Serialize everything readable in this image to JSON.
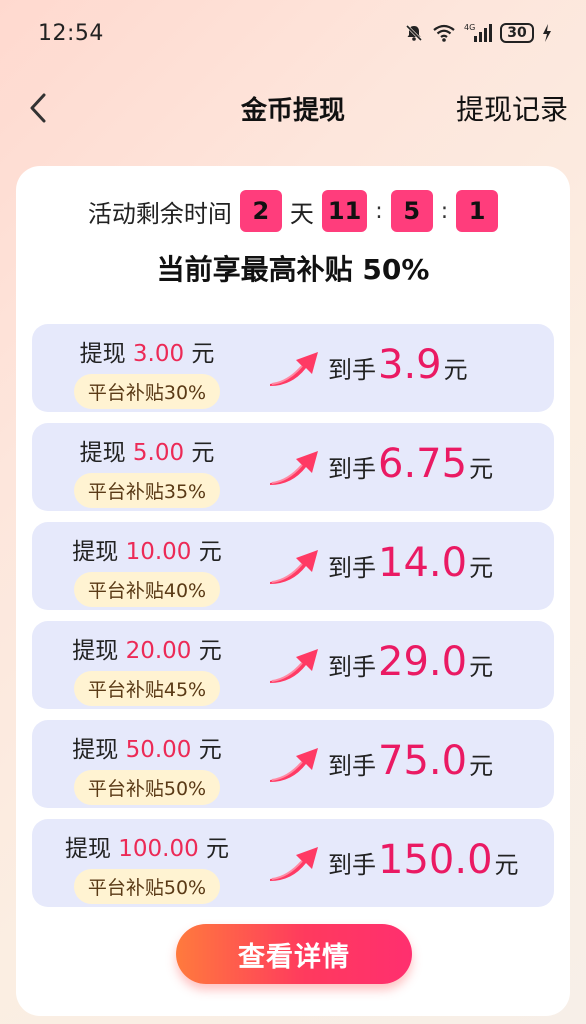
{
  "status_bar": {
    "time": "12:54",
    "battery": "30",
    "network": "4G",
    "icons": [
      "mute-icon",
      "wifi-icon",
      "signal-icon",
      "battery-icon",
      "charging-icon"
    ]
  },
  "header": {
    "title": "金币提现",
    "records_label": "提现记录",
    "back_icon": "chevron-left-icon"
  },
  "countdown": {
    "label": "活动剩余时间",
    "days": "2",
    "days_unit": "天",
    "hours": "11",
    "minutes": "5",
    "seconds": "1",
    "separator": ":"
  },
  "subsidy_headline": "当前享最高补贴 50%",
  "options": [
    {
      "prefix": "提现",
      "amount": "3.00",
      "unit": "元",
      "badge": "平台补贴30%",
      "receive_label": "到手",
      "receive_value": "3.9",
      "receive_unit": "元"
    },
    {
      "prefix": "提现",
      "amount": "5.00",
      "unit": "元",
      "badge": "平台补贴35%",
      "receive_label": "到手",
      "receive_value": "6.75",
      "receive_unit": "元"
    },
    {
      "prefix": "提现",
      "amount": "10.00",
      "unit": "元",
      "badge": "平台补贴40%",
      "receive_label": "到手",
      "receive_value": "14.0",
      "receive_unit": "元"
    },
    {
      "prefix": "提现",
      "amount": "20.00",
      "unit": "元",
      "badge": "平台补贴45%",
      "receive_label": "到手",
      "receive_value": "29.0",
      "receive_unit": "元"
    },
    {
      "prefix": "提现",
      "amount": "50.00",
      "unit": "元",
      "badge": "平台补贴50%",
      "receive_label": "到手",
      "receive_value": "75.0",
      "receive_unit": "元"
    },
    {
      "prefix": "提现",
      "amount": "100.00",
      "unit": "元",
      "badge": "平台补贴50%",
      "receive_label": "到手",
      "receive_value": "150.0",
      "receive_unit": "元"
    }
  ],
  "cta_label": "查看详情",
  "colors": {
    "accent": "#ea1a63",
    "countdown_box": "#ff3d7c",
    "option_bg": "#e6e9fb",
    "badge_bg": "#fff3d2"
  }
}
